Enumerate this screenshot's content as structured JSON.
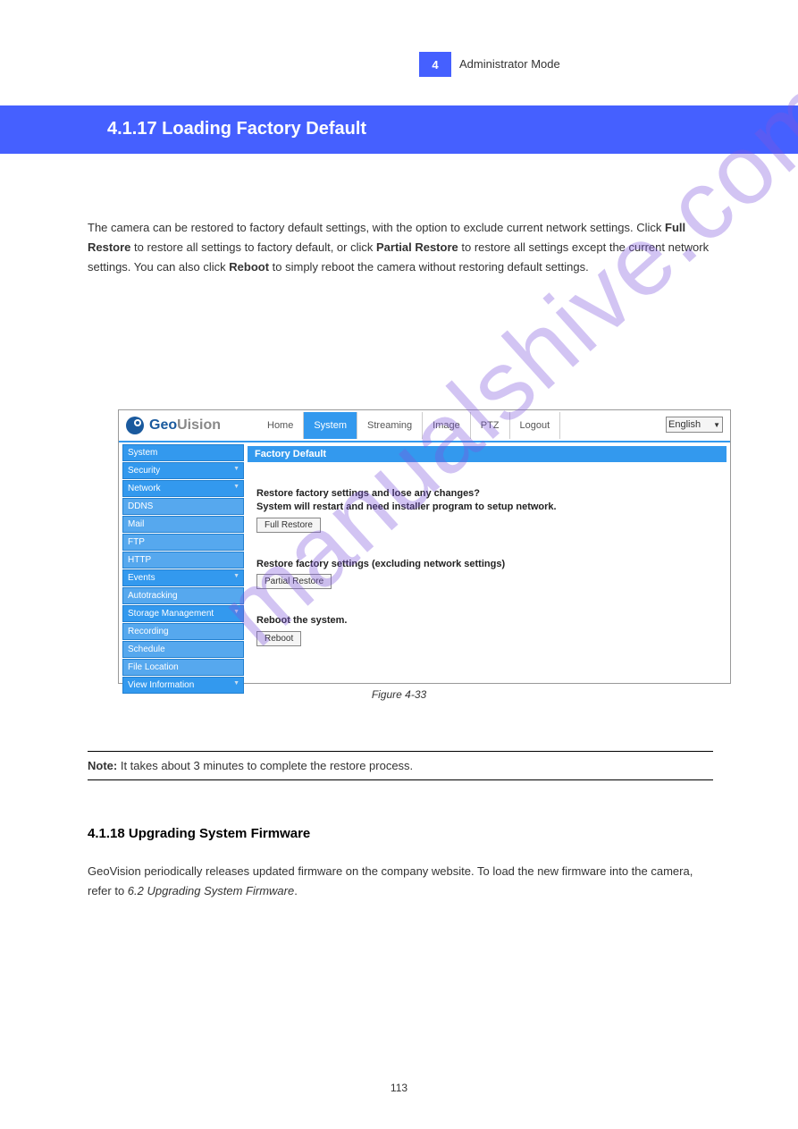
{
  "page_number_box": "4",
  "chapter": "Administrator Mode",
  "heading": "4.1.17  Loading Factory Default",
  "intro_p1": "The camera can be restored to factory default settings, with the option to exclude current network settings. Click ",
  "intro_full": "Full Restore",
  "intro_p2": " to restore all settings to factory default, or click ",
  "intro_partial": "Partial Restore",
  "intro_p3": " to restore all settings except the current network settings. You can also click ",
  "intro_reboot": "Reboot",
  "intro_p4": " to simply reboot the camera without restoring default settings.",
  "screenshot": {
    "brand1": "Geo",
    "brand2": "Uision",
    "topnav": [
      "Home",
      "System",
      "Streaming",
      "Image",
      "PTZ",
      "Logout"
    ],
    "topnav_active_index": 1,
    "lang": "English",
    "sidenav": [
      {
        "label": "System",
        "sub": false,
        "arrow": false
      },
      {
        "label": "Security",
        "sub": false,
        "arrow": true
      },
      {
        "label": "Network",
        "sub": false,
        "arrow": true
      },
      {
        "label": "DDNS",
        "sub": true,
        "arrow": false
      },
      {
        "label": "Mail",
        "sub": true,
        "arrow": false
      },
      {
        "label": "FTP",
        "sub": true,
        "arrow": false
      },
      {
        "label": "HTTP",
        "sub": true,
        "arrow": false
      },
      {
        "label": "Events",
        "sub": false,
        "arrow": true
      },
      {
        "label": "Autotracking",
        "sub": true,
        "arrow": false
      },
      {
        "label": "Storage Management",
        "sub": false,
        "arrow": true
      },
      {
        "label": "Recording",
        "sub": true,
        "arrow": false
      },
      {
        "label": "Schedule",
        "sub": true,
        "arrow": false
      },
      {
        "label": "File Location",
        "sub": true,
        "arrow": false
      },
      {
        "label": "View Information",
        "sub": false,
        "arrow": true
      }
    ],
    "panel_title": "Factory Default",
    "restore1_l1": "Restore factory settings and lose any changes?",
    "restore1_l2": "System will restart and need installer program to setup network.",
    "btn_full": "Full Restore",
    "restore2_l1": "Restore factory settings (excluding network settings)",
    "btn_partial": "Partial Restore",
    "reboot_l1": "Reboot the system.",
    "btn_reboot": "Reboot"
  },
  "figure_caption": "Figure 4-33",
  "note_label": "Note:",
  "note_text": " It takes about 3 minutes to complete the restore process.",
  "section2_title": "4.1.18  Upgrading System Firmware",
  "section2_text": "GeoVision periodically releases updated firmware on the company website. To load the new firmware into the camera, refer to ",
  "section2_link": "6.2 Upgrading System Firmware",
  "section2_tail": ".",
  "watermark": "manualshive.com",
  "footer_page": "113"
}
